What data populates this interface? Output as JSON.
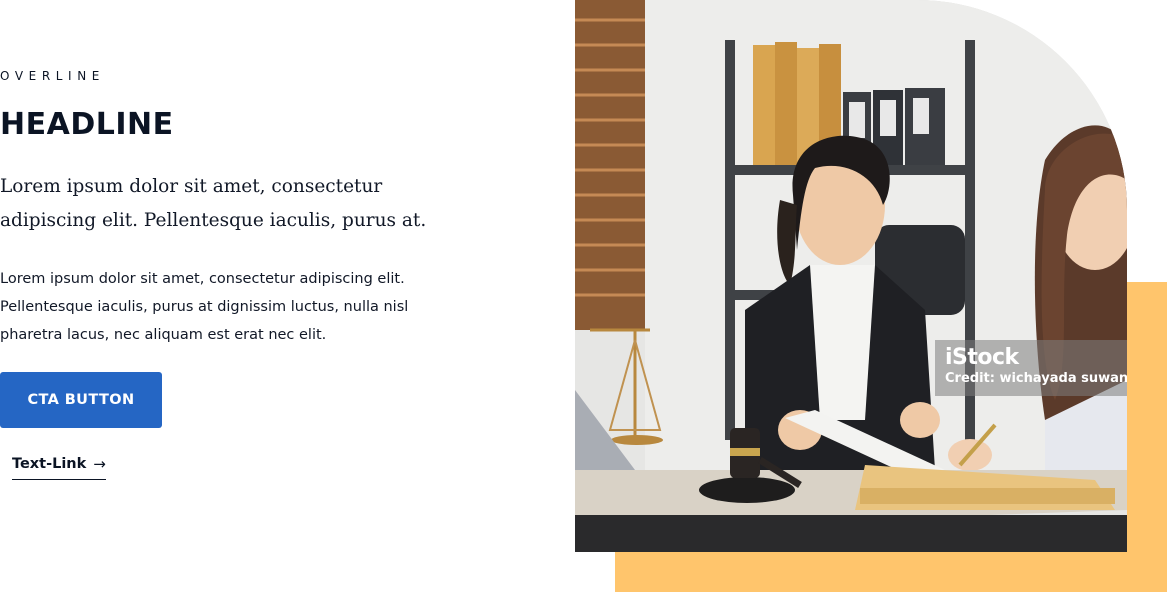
{
  "hero": {
    "overline": "OVERLINE",
    "headline": "HEADLINE",
    "lead": "Lorem ipsum dolor sit amet, consectetur adipiscing elit. Pellentesque iaculis, purus at.",
    "body": "Lorem ipsum dolor sit amet, consectetur adipiscing elit. Pellentesque iaculis, purus at dignissim luctus, nulla nisl pharetra lacus, nec aliquam est erat nec elit.",
    "cta_label": "CTA BUTTON",
    "link_label": "Text-Link",
    "link_icon": "arrow-right-icon"
  },
  "image": {
    "watermark_logo": "iStock",
    "watermark_credit": "Credit: wichayada suwanachun"
  },
  "colors": {
    "cta_background": "#2566c4",
    "accent_block": "#ffc56c",
    "text": "#0b1424"
  }
}
